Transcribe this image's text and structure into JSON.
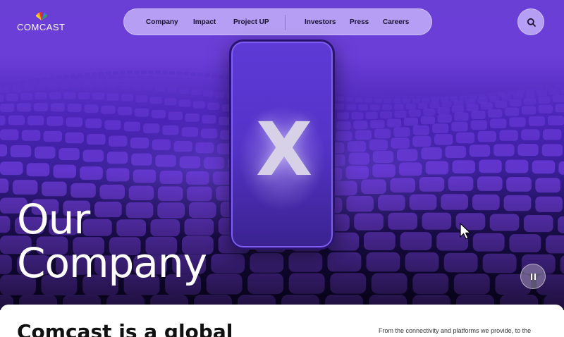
{
  "brand": {
    "name": "COMCAST",
    "logo_icon": "peacock-icon"
  },
  "nav": {
    "items": [
      {
        "label": "Company"
      },
      {
        "label": "Impact"
      },
      {
        "label": "Project UP"
      },
      {
        "label": "Investors"
      },
      {
        "label": "Press"
      },
      {
        "label": "Careers"
      }
    ]
  },
  "search": {
    "icon": "search-icon"
  },
  "hero": {
    "title_line1": "Our",
    "title_line2": "Company",
    "phone_logo": "X",
    "pause_icon": "pause-icon"
  },
  "intro": {
    "heading": "Comcast is a global",
    "body": "From the connectivity and platforms we provide, to the"
  },
  "colors": {
    "accent": "#6b3ed8",
    "nav_bg": "#d2c3ff",
    "text_dark": "#1a1230"
  }
}
